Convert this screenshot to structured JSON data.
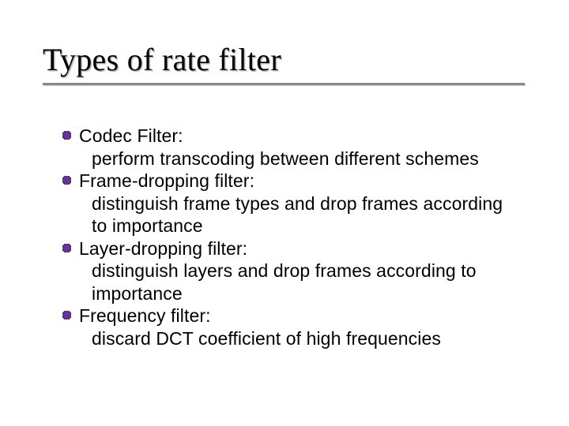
{
  "title": "Types of rate filter",
  "items": [
    {
      "heading": "Codec Filter:",
      "desc": "perform transcoding between different schemes"
    },
    {
      "heading": "Frame-dropping filter:",
      "desc": "distinguish frame types and drop frames according to importance"
    },
    {
      "heading": "Layer-dropping filter:",
      "desc": "distinguish layers and drop frames according to importance"
    },
    {
      "heading": "Frequency filter:",
      "desc": "discard DCT coefficient of high frequencies"
    }
  ]
}
